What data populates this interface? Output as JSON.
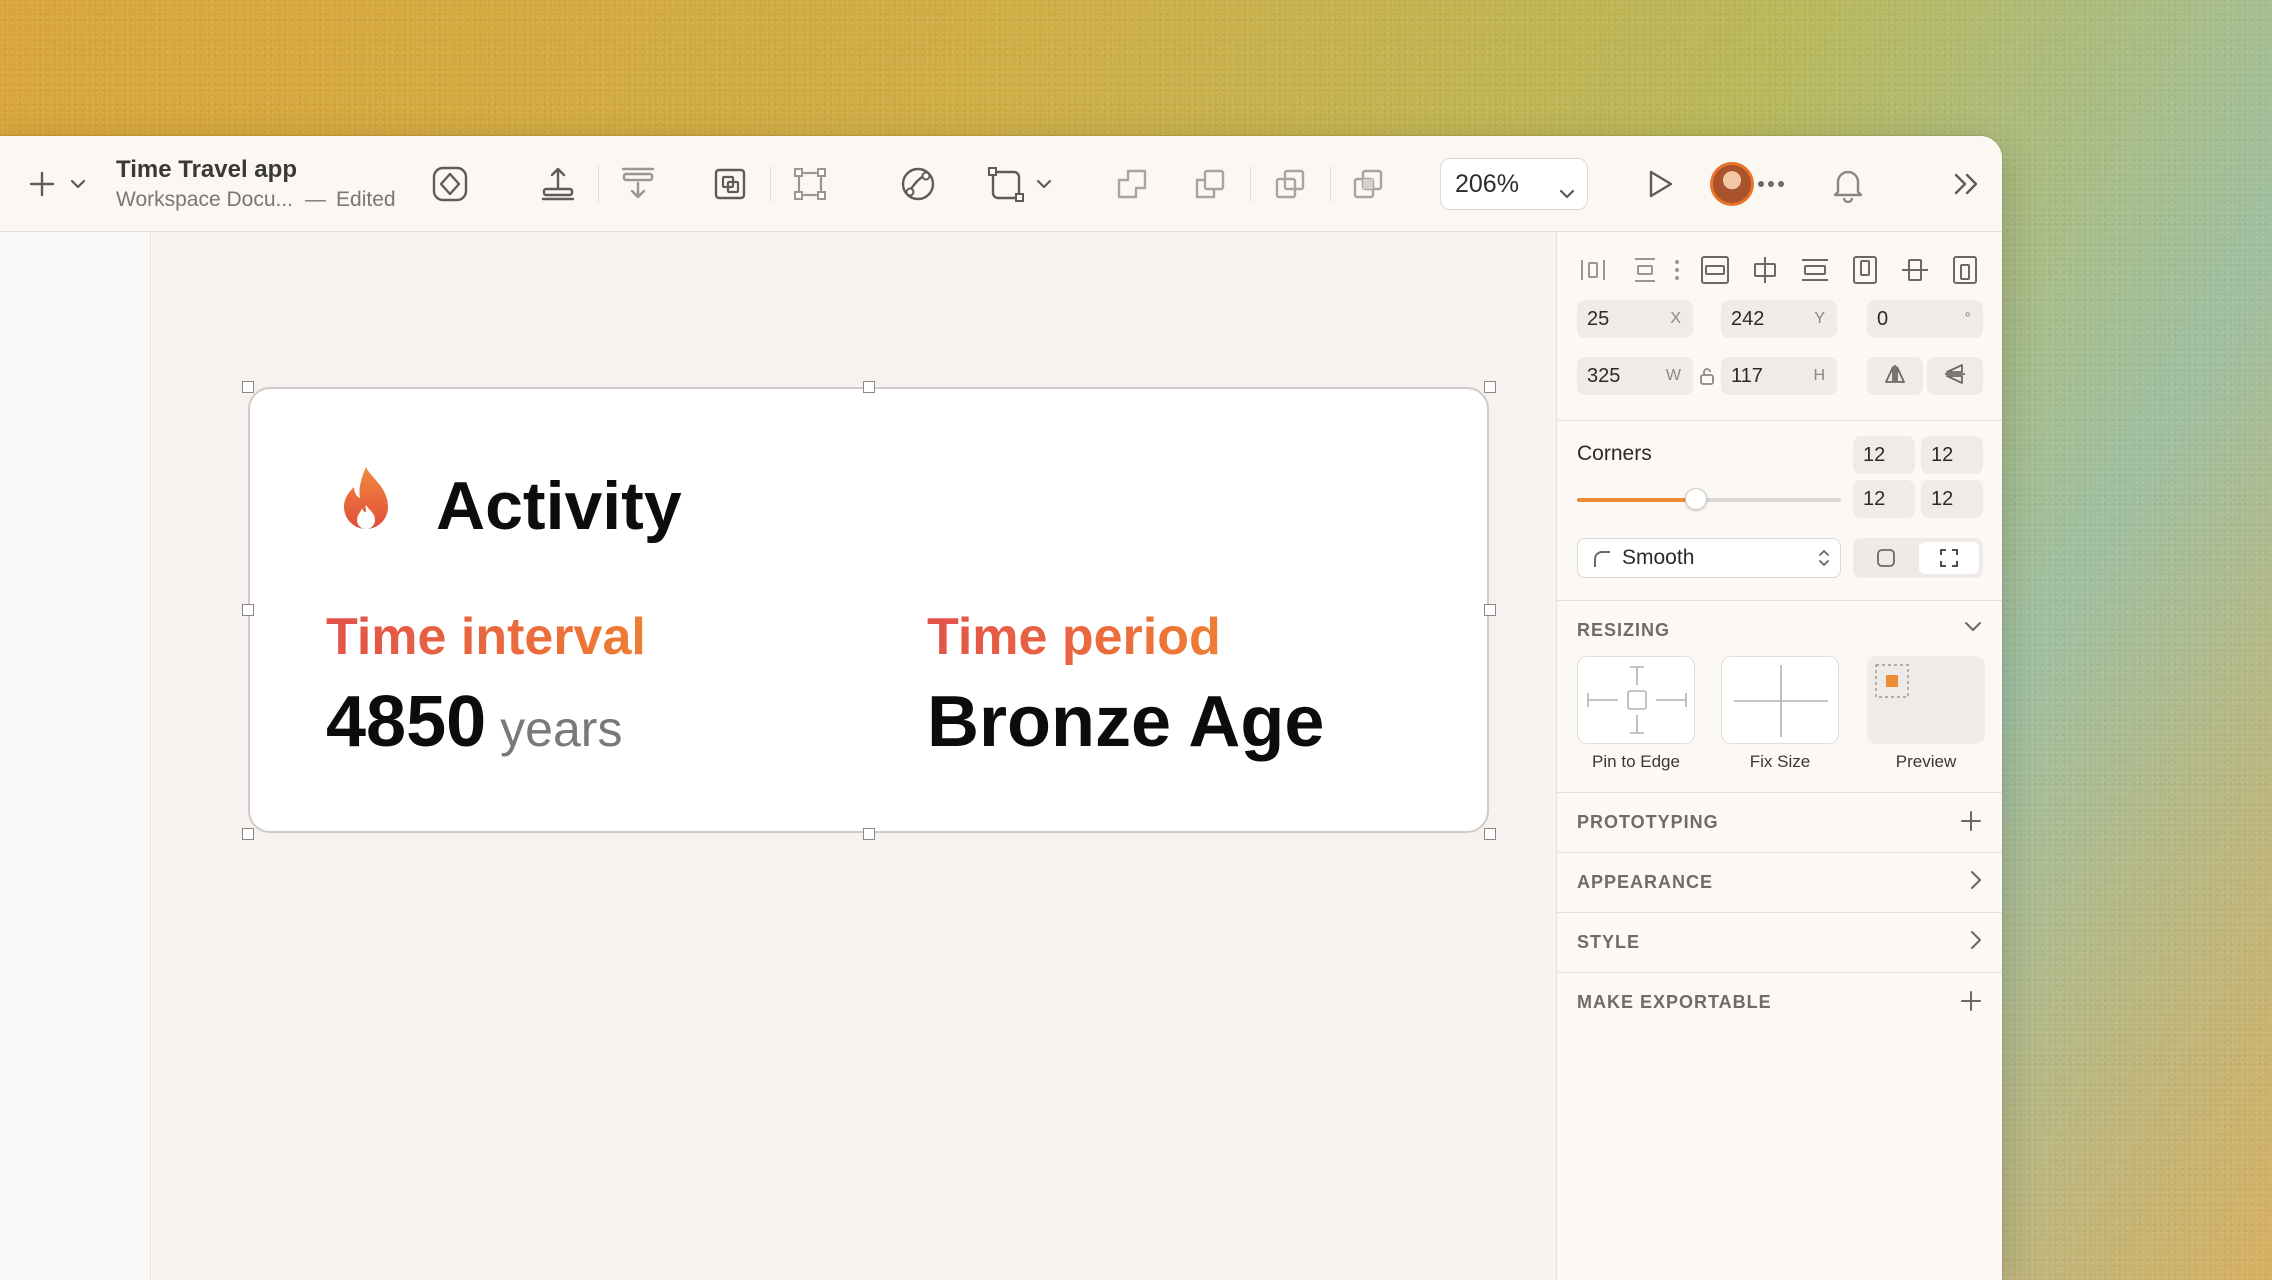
{
  "document": {
    "title": "Time Travel app",
    "subtitle": "Workspace Docu...",
    "separator": "—",
    "status": "Edited"
  },
  "toolbar": {
    "zoom_value": "206%",
    "icons": [
      "plus-icon",
      "chevron-down-icon",
      "symbol-icon",
      "align-icon",
      "distribute-icon",
      "frame-icon",
      "transform-icon",
      "mask-icon",
      "shape-icon",
      "union-icon",
      "subtract-icon",
      "intersect-icon",
      "difference-icon",
      "play-icon",
      "more-icon",
      "bell-icon",
      "expand-icon"
    ]
  },
  "card": {
    "title": "Activity",
    "left_label": "Time interval",
    "left_value": "4850",
    "left_unit": "years",
    "right_label": "Time period",
    "right_value": "Bronze Age"
  },
  "inspector": {
    "x": "25",
    "x_label": "X",
    "y": "242",
    "y_label": "Y",
    "rotation": "0",
    "rotation_label": "°",
    "width": "325",
    "width_label": "W",
    "height": "117",
    "height_label": "H",
    "corners_label": "Corners",
    "corners": [
      "12",
      "12",
      "12",
      "12"
    ],
    "corner_slider_fraction": 0.45,
    "corner_style": "Smooth",
    "sections": {
      "resizing": "RESIZING",
      "prototyping": "PROTOTYPING",
      "appearance": "APPEARANCE",
      "style": "STYLE",
      "make_exportable": "MAKE EXPORTABLE"
    },
    "resizing_options": [
      "Pin to Edge",
      "Fix Size",
      "Preview"
    ]
  },
  "colors": {
    "accent": "#ef8a35",
    "accent_red": "#e2524a"
  }
}
